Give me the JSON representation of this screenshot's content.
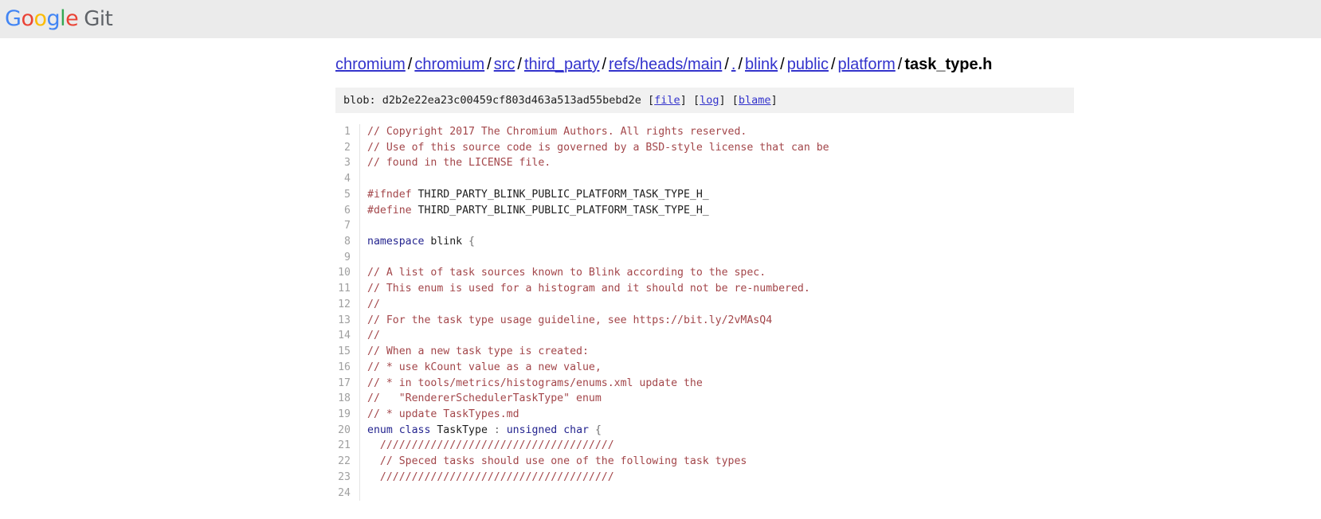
{
  "header": {
    "logo": {
      "google_letters": [
        {
          "char": "G",
          "color": "#4285f4"
        },
        {
          "char": "o",
          "color": "#ea4335"
        },
        {
          "char": "o",
          "color": "#fbbc05"
        },
        {
          "char": "g",
          "color": "#4285f4"
        },
        {
          "char": "l",
          "color": "#34a853"
        },
        {
          "char": "e",
          "color": "#ea4335"
        }
      ],
      "product_name": "Git"
    },
    "background_color": "#ebebeb"
  },
  "breadcrumb": {
    "items": [
      {
        "label": "chromium",
        "is_link": true
      },
      {
        "label": "chromium",
        "is_link": true
      },
      {
        "label": "src",
        "is_link": true
      },
      {
        "label": "third_party",
        "is_link": true
      },
      {
        "label": "refs/heads/main",
        "is_link": true
      },
      {
        "label": ".",
        "is_link": true
      },
      {
        "label": "blink",
        "is_link": true
      },
      {
        "label": "public",
        "is_link": true
      },
      {
        "label": "platform",
        "is_link": true
      },
      {
        "label": "task_type.h",
        "is_link": false
      }
    ],
    "separator": "/",
    "link_color": "#3333cc"
  },
  "blob_bar": {
    "label": "blob:",
    "hash": "d2b2e22ea23c00459cf803d463a513ad55bebd2e",
    "actions": [
      {
        "label": "file"
      },
      {
        "label": "log"
      },
      {
        "label": "blame"
      }
    ],
    "background_color": "#f1f1f1"
  },
  "code": {
    "language": "cpp",
    "line_number_color": "#a0a0a0",
    "comment_color": "#a3464a",
    "keyword_color": "#24248f",
    "lines": [
      {
        "n": 1,
        "tokens": [
          {
            "t": "// Copyright 2017 The Chromium Authors. All rights reserved.",
            "k": "c"
          }
        ]
      },
      {
        "n": 2,
        "tokens": [
          {
            "t": "// Use of this source code is governed by a BSD-style license that can be",
            "k": "c"
          }
        ]
      },
      {
        "n": 3,
        "tokens": [
          {
            "t": "// found in the LICENSE file.",
            "k": "c"
          }
        ]
      },
      {
        "n": 4,
        "tokens": []
      },
      {
        "n": 5,
        "tokens": [
          {
            "t": "#ifndef",
            "k": "pp"
          },
          {
            "t": " THIRD_PARTY_BLINK_PUBLIC_PLATFORM_TASK_TYPE_H_",
            "k": "id"
          }
        ]
      },
      {
        "n": 6,
        "tokens": [
          {
            "t": "#define",
            "k": "pp"
          },
          {
            "t": " THIRD_PARTY_BLINK_PUBLIC_PLATFORM_TASK_TYPE_H_",
            "k": "id"
          }
        ]
      },
      {
        "n": 7,
        "tokens": []
      },
      {
        "n": 8,
        "tokens": [
          {
            "t": "namespace",
            "k": "kw"
          },
          {
            "t": " blink ",
            "k": "id"
          },
          {
            "t": "{",
            "k": "pn"
          }
        ]
      },
      {
        "n": 9,
        "tokens": []
      },
      {
        "n": 10,
        "tokens": [
          {
            "t": "// A list of task sources known to Blink according to the spec.",
            "k": "c"
          }
        ]
      },
      {
        "n": 11,
        "tokens": [
          {
            "t": "// This enum is used for a histogram and it should not be re-numbered.",
            "k": "c"
          }
        ]
      },
      {
        "n": 12,
        "tokens": [
          {
            "t": "//",
            "k": "c"
          }
        ]
      },
      {
        "n": 13,
        "tokens": [
          {
            "t": "// For the task type usage guideline, see https://bit.ly/2vMAsQ4",
            "k": "c"
          }
        ]
      },
      {
        "n": 14,
        "tokens": [
          {
            "t": "//",
            "k": "c"
          }
        ]
      },
      {
        "n": 15,
        "tokens": [
          {
            "t": "// When a new task type is created:",
            "k": "c"
          }
        ]
      },
      {
        "n": 16,
        "tokens": [
          {
            "t": "// * use kCount value as a new value,",
            "k": "c"
          }
        ]
      },
      {
        "n": 17,
        "tokens": [
          {
            "t": "// * in tools/metrics/histograms/enums.xml update the",
            "k": "c"
          }
        ]
      },
      {
        "n": 18,
        "tokens": [
          {
            "t": "//   \"RendererSchedulerTaskType\" enum",
            "k": "c"
          }
        ]
      },
      {
        "n": 19,
        "tokens": [
          {
            "t": "// * update TaskTypes.md",
            "k": "c"
          }
        ]
      },
      {
        "n": 20,
        "tokens": [
          {
            "t": "enum",
            "k": "kw"
          },
          {
            "t": " ",
            "k": "id"
          },
          {
            "t": "class",
            "k": "kw"
          },
          {
            "t": " TaskType ",
            "k": "id"
          },
          {
            "t": ":",
            "k": "pn"
          },
          {
            "t": " ",
            "k": "id"
          },
          {
            "t": "unsigned",
            "k": "kw"
          },
          {
            "t": " ",
            "k": "id"
          },
          {
            "t": "char",
            "k": "kw"
          },
          {
            "t": " ",
            "k": "id"
          },
          {
            "t": "{",
            "k": "pn"
          }
        ]
      },
      {
        "n": 21,
        "tokens": [
          {
            "t": "  /////////////////////////////////////",
            "k": "c"
          }
        ]
      },
      {
        "n": 22,
        "tokens": [
          {
            "t": "  // Speced tasks should use one of the following task types",
            "k": "c"
          }
        ]
      },
      {
        "n": 23,
        "tokens": [
          {
            "t": "  /////////////////////////////////////",
            "k": "c"
          }
        ]
      },
      {
        "n": 24,
        "tokens": []
      }
    ]
  }
}
